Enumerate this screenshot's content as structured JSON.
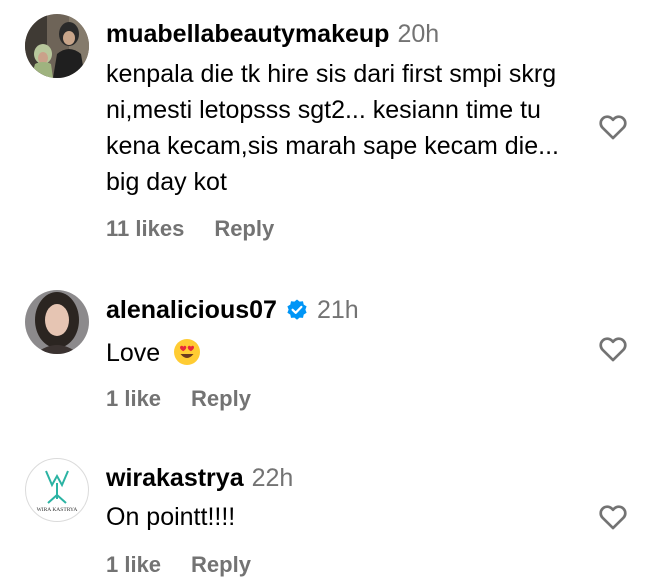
{
  "comments": [
    {
      "username": "muabellabeautymakeup",
      "time": "20h",
      "text": "kenpala die tk hire sis dari first smpi skrg ni,mesti letopsss sgt2... kesiann time tu kena kecam,sis marah sape kecam die... big day kot",
      "likes": "11 likes",
      "reply": "Reply",
      "verified": false
    },
    {
      "username": "alenalicious07",
      "time": "21h",
      "text": "Love",
      "emoji": "heart-eyes-emoji",
      "likes": "1 like",
      "reply": "Reply",
      "verified": true
    },
    {
      "username": "wirakastrya",
      "time": "22h",
      "text": "On pointt!!!!",
      "likes": "1 like",
      "reply": "Reply",
      "verified": false,
      "avatar_text": "WIRA KASTRYA"
    }
  ],
  "colors": {
    "meta_gray": "#737373",
    "verified_blue": "#0095F6",
    "logo_teal": "#2bb3a3"
  }
}
